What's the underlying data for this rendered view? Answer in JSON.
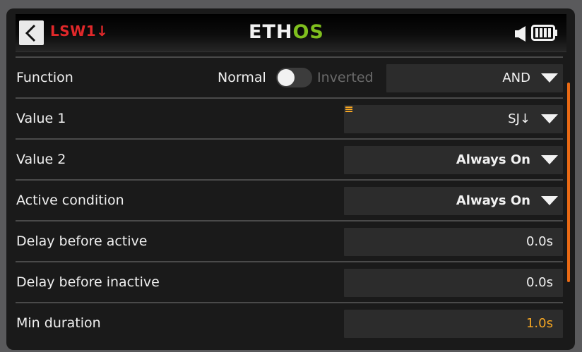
{
  "header": {
    "title": "LSW1↓",
    "logo_main": "ETH",
    "logo_accent": "OS",
    "back_icon": "chevron-left-icon",
    "status_icons": [
      "speaker-icon",
      "battery-icon"
    ]
  },
  "rows": {
    "function": {
      "label": "Function",
      "toggle_off_label": "Normal",
      "toggle_on_label": "Inverted",
      "toggle_state": "Normal",
      "value": "AND"
    },
    "value1": {
      "label": "Value 1",
      "value": "SJ↓"
    },
    "value2": {
      "label": "Value 2",
      "value": "Always On"
    },
    "active_condition": {
      "label": "Active condition",
      "value": "Always On"
    },
    "delay_active": {
      "label": "Delay before active",
      "value": "0.0s"
    },
    "delay_inactive": {
      "label": "Delay before inactive",
      "value": "0.0s"
    },
    "min_duration": {
      "label": "Min duration",
      "value": "1.0s"
    }
  },
  "colors": {
    "title_red": "#e0282a",
    "logo_green": "#7fbf1e",
    "accent_orange": "#f5a623",
    "scrollbar_orange": "#ea6a14",
    "background": "#1a1a1a",
    "field_background": "#2c2c2c"
  }
}
